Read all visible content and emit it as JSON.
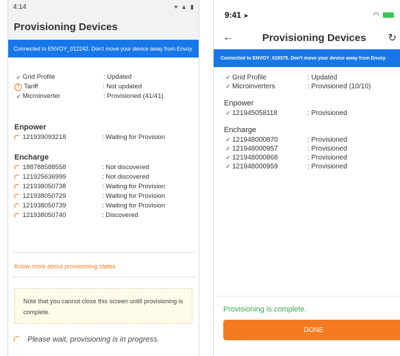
{
  "android": {
    "status_bar": {
      "time": "4:14"
    },
    "title": "Provisioning Devices",
    "banner": "Connected to ENVOY_012242. Don't move your device away from Envoy.",
    "status_items": [
      {
        "label": "Grid Profile",
        "value": ": Updated",
        "mark": "check"
      },
      {
        "label": "Tariff",
        "value": ": Not updated",
        "mark": "warning"
      },
      {
        "label": "Microinverter",
        "value": ": Provisioned (41/41)",
        "mark": "check"
      }
    ],
    "enpower": {
      "heading": "Enpower",
      "items": [
        {
          "serial": "121939093218",
          "value": ": Waiting for Provision"
        }
      ]
    },
    "encharge": {
      "heading": "Encharge",
      "items": [
        {
          "serial": "188788588558",
          "value": ": Not discovered"
        },
        {
          "serial": "121925636999",
          "value": ": Not discovered"
        },
        {
          "serial": "121938050738",
          "value": ": Waiting for Provision"
        },
        {
          "serial": "121938050729",
          "value": ": Waiting for Provision"
        },
        {
          "serial": "121938050739",
          "value": ": Waiting for Provision"
        },
        {
          "serial": "121938050740",
          "value": ": Discovered"
        }
      ]
    },
    "link": "Know more about provisioning states",
    "note": "Note that you cannot close this screen untill provisioning is complete.",
    "wait_text": "Please wait, provisioning is in progress."
  },
  "ios": {
    "status_bar": {
      "time": "9:41"
    },
    "title": "Provisioning Devices",
    "banner": "Connected to ENVOY_019375. Don't move your device away from Envoy.",
    "status_items": [
      {
        "label": "Grid Profile",
        "value": ": Updated"
      },
      {
        "label": "Microinverters",
        "value": ": Provisioned (10/10)"
      }
    ],
    "enpower": {
      "heading": "Enpower",
      "items": [
        {
          "serial": "121945058118",
          "value": ": Provisioned"
        }
      ]
    },
    "encharge": {
      "heading": "Encharge",
      "items": [
        {
          "serial": "121948000870",
          "value": ": Provisioned"
        },
        {
          "serial": "121948000957",
          "value": ": Provisioned"
        },
        {
          "serial": "121948000868",
          "value": ": Provisioned"
        },
        {
          "serial": "121948000959",
          "value": ": Provisioned"
        }
      ]
    },
    "complete_text": "Provisioning is complete.",
    "done_label": "DONE"
  },
  "colors": {
    "accent": "#f47b20",
    "banner": "#1877e8",
    "success": "#35a853"
  }
}
